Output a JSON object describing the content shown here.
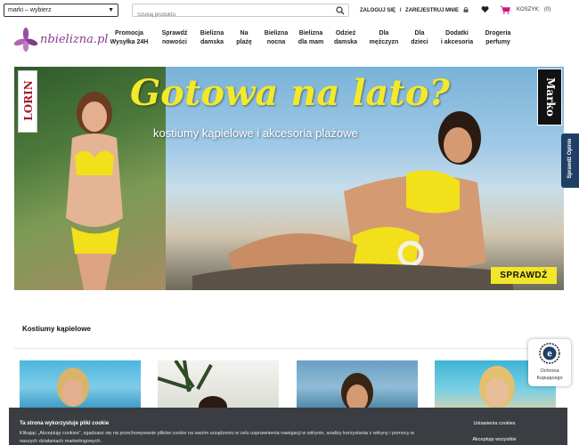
{
  "header": {
    "brand_select": {
      "value": "marki – wybierz"
    },
    "search": {
      "placeholder": "Szukaj produktu"
    },
    "login_label": "ZALOGUJ SIĘ",
    "separator": "/",
    "register_label": "ZAREJESTRUJ MNIE",
    "cart_label": "KOSZYK:",
    "cart_count": "(0)"
  },
  "logo": {
    "text": "nbielizna.pl"
  },
  "nav": {
    "items": [
      {
        "line1": "Promocja",
        "line2": "Wysyłka 24H"
      },
      {
        "line1": "Sprawdź",
        "line2": "nowości"
      },
      {
        "line1": "Bielizna",
        "line2": "damska"
      },
      {
        "line1": "Na",
        "line2": "plażę"
      },
      {
        "line1": "Bielizna",
        "line2": "nocna"
      },
      {
        "line1": "Bielizna",
        "line2": "dla mam"
      },
      {
        "line1": "Odzież",
        "line2": "damska"
      },
      {
        "line1": "Dla",
        "line2": "mężczyzn"
      },
      {
        "line1": "Dla",
        "line2": "dzieci"
      },
      {
        "line1": "Dodatki",
        "line2": "i akcesoria"
      },
      {
        "line1": "Drogeria",
        "line2": "perfumy"
      }
    ]
  },
  "banner": {
    "title": "Gotowa na lato?",
    "subtitle": "kostiumy kąpielowe i akcesoria plażowe",
    "brand_left": "LORIN",
    "brand_right": "Marko",
    "cta_label": "SPRAWDŹ"
  },
  "side_tab": {
    "label": "Sprawdź Opinie"
  },
  "section": {
    "title": "Kostiumy kąpielowe"
  },
  "ochrona": {
    "line1": "Ochrona",
    "line2": "Kupującego"
  },
  "cookie": {
    "title": "Ta strona wykorzystuje pliki cookie",
    "text": "Klikając „Akceptuję cookies”, zgadzasz się na przechowywanie plików cookie na swoim urządzeniu w celu usprawnienia nawigacji w witrynie, analizy korzystania z witryny i pomocy w naszych działaniach marketingowych.",
    "settings_label": "Ustawienia cookies",
    "accept_label": "Akceptuję wszystkie"
  },
  "colors": {
    "accent_yellow": "#f2e62a",
    "logo_purple": "#8a3b8f",
    "side_tab_navy": "#1f3f66",
    "cookie_bg": "#3a3e42"
  },
  "icons": {
    "search": "search-icon",
    "heart": "heart-icon",
    "cart": "cart-icon",
    "lock": "lock-icon",
    "logo": "orchid-logo-icon",
    "trust": "e-trust-icon"
  }
}
